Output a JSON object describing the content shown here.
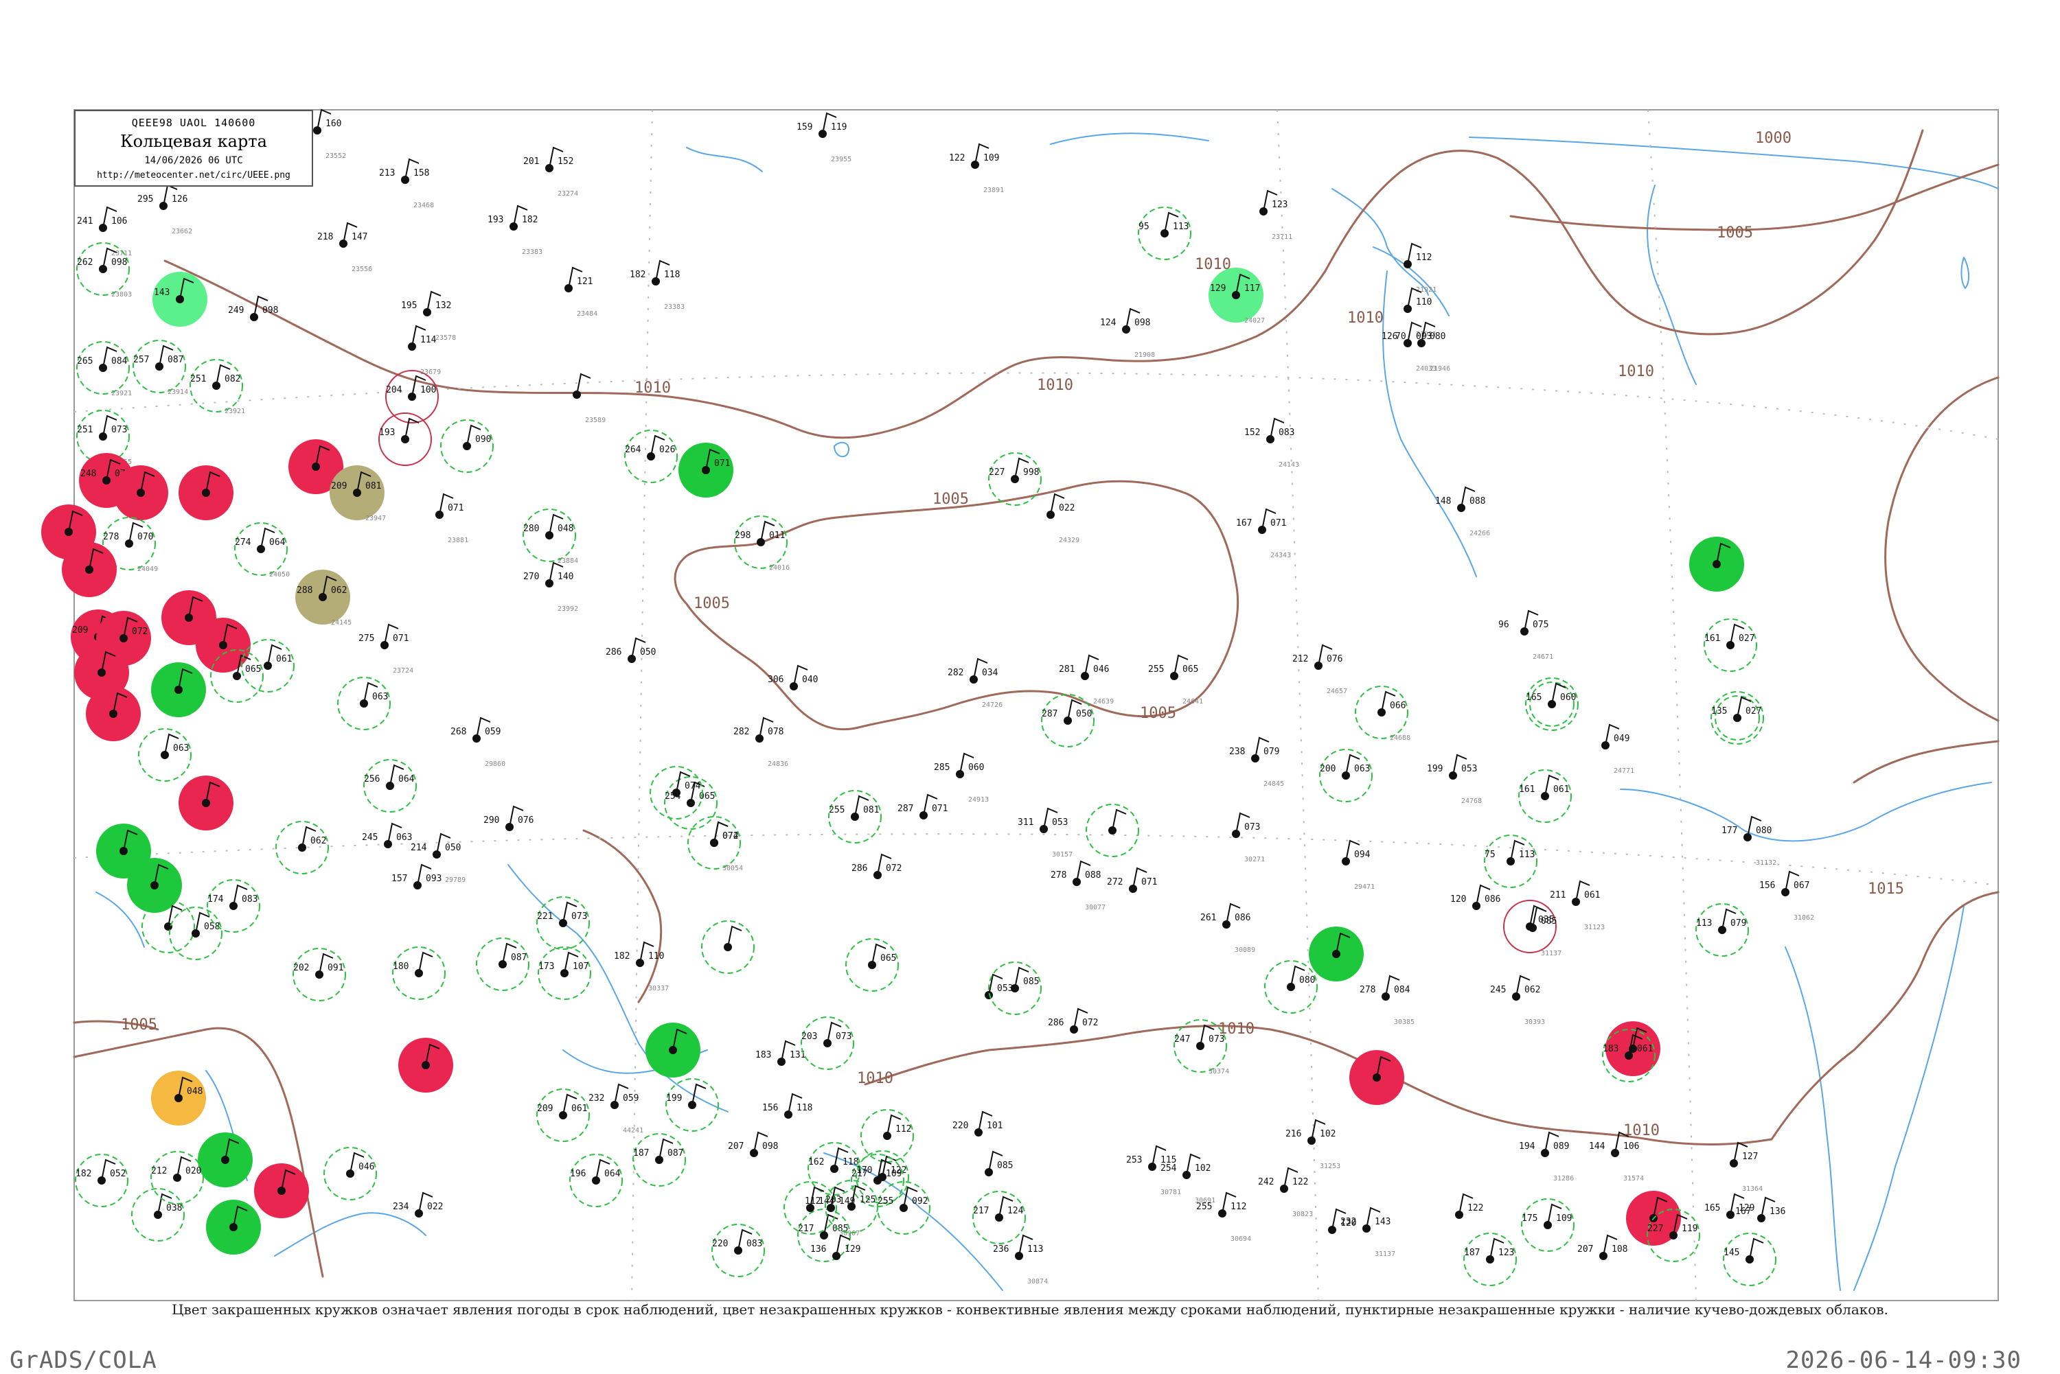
{
  "legend": {
    "code": "QEEE98  UAOL  140600",
    "title": "Кольцевая карта",
    "date": "14/06/2026 06 UTC",
    "url": "http://meteocenter.net/circ/UEEE.png"
  },
  "caption": "Цвет закрашенных кружков означает явления погоды в срок наблюдений, цвет незакрашенных кружков - конвективные явления между сроками наблюдений, пунктирные незакрашенные кружки - наличие кучево-дождевых облаков.",
  "footer": {
    "credit": "GrADS/COLA",
    "timestamp": "2026-06-14-09:30"
  },
  "colors": {
    "isobar": "#a0695a",
    "water": "#5aa6e6",
    "frame": "#999999",
    "red": "#e8264f",
    "green": "#1ec83c",
    "lightgreen": "#5cf08c",
    "olive": "#b5ad78",
    "orange": "#f5b840",
    "dash": "#2fbf44"
  },
  "isobar_labels": [
    "1000",
    "1005",
    "1005",
    "1005",
    "1005",
    "1010",
    "1010",
    "1010",
    "1010",
    "1010",
    "1010",
    "1010",
    "1010",
    "1015",
    "1005"
  ],
  "stations": [
    {
      "p": "160",
      "t": "",
      "n": "23552",
      "s": ""
    },
    {
      "p": "126",
      "t": "295",
      "n": "23662",
      "s": "s"
    },
    {
      "p": "106",
      "t": "241",
      "n": "23711",
      "s": ""
    },
    {
      "p": "098",
      "t": "262",
      "n": "23803",
      "s": "d"
    },
    {
      "p": "",
      "t": "143",
      "n": "",
      "s": "lg"
    },
    {
      "p": "098",
      "t": "249",
      "n": "",
      "s": ""
    },
    {
      "p": "084",
      "t": "265",
      "n": "23921",
      "s": "d"
    },
    {
      "p": "087",
      "t": "257",
      "n": "23914",
      "s": "d"
    },
    {
      "p": "082",
      "t": "251",
      "n": "23921",
      "s": "d"
    },
    {
      "p": "073",
      "t": "251",
      "n": "23955",
      "s": "d"
    },
    {
      "p": "074",
      "t": "248",
      "n": "",
      "s": "r"
    },
    {
      "p": "",
      "t": "",
      "n": "",
      "s": "r"
    },
    {
      "p": "",
      "t": "",
      "n": "",
      "s": "r"
    },
    {
      "p": "",
      "t": "",
      "n": "",
      "s": "r"
    },
    {
      "p": "070",
      "t": "278",
      "n": "24049",
      "s": "d"
    },
    {
      "p": "064",
      "t": "274",
      "n": "24050",
      "s": "d"
    },
    {
      "p": "",
      "t": "",
      "n": "",
      "s": "r"
    },
    {
      "p": "",
      "t": "",
      "n": "",
      "s": "r"
    },
    {
      "p": "",
      "t": "",
      "n": "",
      "s": "r"
    },
    {
      "p": "",
      "t": "",
      "n": "",
      "s": "r"
    },
    {
      "p": "",
      "t": "209",
      "n": "",
      "s": "r"
    },
    {
      "p": "081",
      "t": "209",
      "n": "23947",
      "s": "o"
    },
    {
      "p": "062",
      "t": "288",
      "n": "24145",
      "s": "o"
    },
    {
      "p": "100",
      "t": "204",
      "n": "",
      "s": "rr"
    },
    {
      "p": "",
      "t": "193",
      "n": "",
      "s": "rr"
    },
    {
      "p": "090",
      "t": "",
      "n": "",
      "s": "d"
    },
    {
      "p": "158",
      "t": "213",
      "n": "23468",
      "s": ""
    },
    {
      "p": "147",
      "t": "218",
      "n": "23556",
      "s": ""
    },
    {
      "p": "132",
      "t": "195",
      "n": "23578",
      "s": ""
    },
    {
      "p": "114",
      "t": "",
      "n": "23679",
      "s": ""
    },
    {
      "p": "152",
      "t": "201",
      "n": "23274",
      "s": ""
    },
    {
      "p": "182",
      "t": "193",
      "n": "23383",
      "s": ""
    },
    {
      "p": "121",
      "t": "",
      "n": "23484",
      "s": ""
    },
    {
      "p": "118",
      "t": "182",
      "n": "23383",
      "s": ""
    },
    {
      "p": "026",
      "t": "264",
      "n": "",
      "s": "d"
    },
    {
      "p": "071",
      "t": "",
      "n": "",
      "s": "g"
    },
    {
      "p": "",
      "t": "",
      "n": "23589",
      "s": ""
    },
    {
      "p": "071",
      "t": "",
      "n": "23881",
      "s": ""
    },
    {
      "p": "048",
      "t": "280",
      "n": "23884",
      "s": "d"
    },
    {
      "p": "140",
      "t": "270",
      "n": "23992",
      "s": ""
    },
    {
      "p": "011",
      "t": "298",
      "n": "24016",
      "s": "d"
    },
    {
      "p": "119",
      "t": "159",
      "n": "23955",
      "s": ""
    },
    {
      "p": "109",
      "t": "122",
      "n": "23891",
      "s": ""
    },
    {
      "p": "113",
      "t": "95",
      "n": "",
      "s": "d"
    },
    {
      "p": "117",
      "t": "129",
      "n": "24027",
      "s": "lg"
    },
    {
      "p": "123",
      "t": "",
      "n": "23711",
      "s": ""
    },
    {
      "p": "098",
      "t": "124",
      "n": "21908",
      "s": ""
    },
    {
      "p": "112",
      "t": "",
      "n": "21921",
      "s": ""
    },
    {
      "p": "110",
      "t": "",
      "n": "21931",
      "s": ""
    },
    {
      "p": "093",
      "t": "126",
      "n": "24033",
      "s": ""
    },
    {
      "p": "083",
      "t": "152",
      "n": "24143",
      "s": ""
    },
    {
      "p": "080",
      "t": "70",
      "n": "21946",
      "s": ""
    },
    {
      "p": "998",
      "t": "227",
      "n": "",
      "s": "d"
    },
    {
      "p": "022",
      "t": "",
      "n": "24329",
      "s": ""
    },
    {
      "p": "071",
      "t": "167",
      "n": "24343",
      "s": ""
    },
    {
      "p": "088",
      "t": "148",
      "n": "24266",
      "s": ""
    },
    {
      "p": "",
      "t": "",
      "n": "",
      "s": "g"
    },
    {
      "p": "071",
      "t": "275",
      "n": "23724",
      "s": ""
    },
    {
      "p": "050",
      "t": "286",
      "n": "",
      "s": ""
    },
    {
      "p": "040",
      "t": "306",
      "n": "",
      "s": ""
    },
    {
      "p": "034",
      "t": "282",
      "n": "24726",
      "s": ""
    },
    {
      "p": "046",
      "t": "281",
      "n": "24639",
      "s": ""
    },
    {
      "p": "065",
      "t": "255",
      "n": "24641",
      "s": ""
    },
    {
      "p": "050",
      "t": "287",
      "n": "",
      "s": "d"
    },
    {
      "p": "076",
      "t": "212",
      "n": "24657",
      "s": ""
    },
    {
      "p": "075",
      "t": "96",
      "n": "24671",
      "s": ""
    },
    {
      "p": "027",
      "t": "161",
      "n": "",
      "s": "d"
    },
    {
      "p": "060",
      "t": "165",
      "n": "",
      "s": "dd"
    },
    {
      "p": "027",
      "t": "135",
      "n": "",
      "s": "dd"
    },
    {
      "p": "066",
      "t": "",
      "n": "24688",
      "s": "d"
    },
    {
      "p": "",
      "t": "",
      "n": "",
      "s": "g"
    },
    {
      "p": "072",
      "t": "",
      "n": "",
      "s": "r"
    },
    {
      "p": "",
      "t": "",
      "n": "",
      "s": "r"
    },
    {
      "p": "",
      "t": "",
      "n": "",
      "s": "r"
    },
    {
      "p": "065",
      "t": "",
      "n": "",
      "s": "d"
    },
    {
      "p": "061",
      "t": "",
      "n": "",
      "s": "d"
    },
    {
      "p": "063",
      "t": "",
      "n": "",
      "s": "d"
    },
    {
      "p": "059",
      "t": "268",
      "n": "29860",
      "s": ""
    },
    {
      "p": "078",
      "t": "282",
      "n": "24836",
      "s": ""
    },
    {
      "p": "060",
      "t": "285",
      "n": "24913",
      "s": ""
    },
    {
      "p": "071",
      "t": "287",
      "n": "",
      "s": ""
    },
    {
      "p": "065",
      "t": "254",
      "n": "",
      "s": "d"
    },
    {
      "p": "074",
      "t": "",
      "n": "",
      "s": "d"
    },
    {
      "p": "079",
      "t": "238",
      "n": "24845",
      "s": ""
    },
    {
      "p": "063",
      "t": "200",
      "n": "",
      "s": "d"
    },
    {
      "p": "053",
      "t": "199",
      "n": "24768",
      "s": ""
    },
    {
      "p": "061",
      "t": "161",
      "n": "",
      "s": "d"
    },
    {
      "p": "049",
      "t": "",
      "n": "24771",
      "s": ""
    },
    {
      "p": "",
      "t": "",
      "n": "",
      "s": "g"
    },
    {
      "p": "063",
      "t": "",
      "n": "",
      "s": "d"
    },
    {
      "p": "064",
      "t": "256",
      "n": "",
      "s": "d"
    },
    {
      "p": "063",
      "t": "245",
      "n": "",
      "s": ""
    },
    {
      "p": "",
      "t": "",
      "n": "",
      "s": "r"
    },
    {
      "p": "",
      "t": "",
      "n": "",
      "s": "g"
    },
    {
      "p": "",
      "t": "",
      "n": "",
      "s": "d"
    },
    {
      "p": "058",
      "t": "",
      "n": "",
      "s": "d"
    },
    {
      "p": "083",
      "t": "174",
      "n": "",
      "s": "d"
    },
    {
      "p": "062",
      "t": "",
      "n": "",
      "s": "d"
    },
    {
      "p": "050",
      "t": "214",
      "n": "29789",
      "s": ""
    },
    {
      "p": "076",
      "t": "290",
      "n": "",
      "s": ""
    },
    {
      "p": "093",
      "t": "157",
      "n": "",
      "s": ""
    },
    {
      "p": "072",
      "t": "",
      "n": "30054",
      "s": ""
    },
    {
      "p": "074",
      "t": "",
      "n": "",
      "s": "d"
    },
    {
      "p": "081",
      "t": "255",
      "n": "",
      "s": "d"
    },
    {
      "p": "072",
      "t": "286",
      "n": "",
      "s": ""
    },
    {
      "p": "053",
      "t": "311",
      "n": "30157",
      "s": ""
    },
    {
      "p": "",
      "t": "",
      "n": "",
      "s": "d"
    },
    {
      "p": "088",
      "t": "278",
      "n": "30077",
      "s": ""
    },
    {
      "p": "071",
      "t": "272",
      "n": "",
      "s": ""
    },
    {
      "p": "073",
      "t": "",
      "n": "30271",
      "s": ""
    },
    {
      "p": "086",
      "t": "261",
      "n": "30089",
      "s": ""
    },
    {
      "p": "094",
      "t": "",
      "n": "29471",
      "s": ""
    },
    {
      "p": "",
      "t": "",
      "n": "",
      "s": "d"
    },
    {
      "p": "073",
      "t": "221",
      "n": "",
      "s": "d"
    },
    {
      "p": "087",
      "t": "",
      "n": "",
      "s": "d"
    },
    {
      "p": "110",
      "t": "182",
      "n": "30337",
      "s": ""
    },
    {
      "p": "107",
      "t": "173",
      "n": "",
      "s": "d"
    },
    {
      "p": "091",
      "t": "202",
      "n": "",
      "s": "d"
    },
    {
      "p": "",
      "t": "180",
      "n": "",
      "s": "d"
    },
    {
      "p": "131",
      "t": "183",
      "n": "",
      "s": ""
    },
    {
      "p": "073",
      "t": "203",
      "n": "",
      "s": "d"
    },
    {
      "p": "065",
      "t": "",
      "n": "",
      "s": "d"
    },
    {
      "p": "053",
      "t": "",
      "n": "",
      "s": ""
    },
    {
      "p": "085",
      "t": "",
      "n": "",
      "s": "d"
    },
    {
      "p": "072",
      "t": "286",
      "n": "",
      "s": ""
    },
    {
      "p": "073",
      "t": "247",
      "n": "30374",
      "s": "d"
    },
    {
      "p": "080",
      "t": "",
      "n": "",
      "s": "d"
    },
    {
      "p": "084",
      "t": "278",
      "n": "30385",
      "s": ""
    },
    {
      "p": "062",
      "t": "245",
      "n": "30393",
      "s": ""
    },
    {
      "p": "061",
      "t": "211",
      "n": "31123",
      "s": ""
    },
    {
      "p": "080",
      "t": "177",
      "n": "31132",
      "s": ""
    },
    {
      "p": "067",
      "t": "156",
      "n": "31062",
      "s": ""
    },
    {
      "p": "079",
      "t": "113",
      "n": "",
      "s": "d"
    },
    {
      "p": "113",
      "t": "75",
      "n": "",
      "s": "d"
    },
    {
      "p": "086",
      "t": "120",
      "n": "",
      "s": ""
    },
    {
      "p": "035",
      "t": "",
      "n": "",
      "s": "rr"
    },
    {
      "p": "",
      "t": "",
      "n": "",
      "s": "r"
    },
    {
      "p": "",
      "t": "",
      "n": "",
      "s": "r"
    },
    {
      "p": "",
      "t": "",
      "n": "",
      "s": "g"
    },
    {
      "p": "085",
      "t": "",
      "n": "31137",
      "s": ""
    },
    {
      "p": "061",
      "t": "183",
      "n": "",
      "s": "d"
    },
    {
      "p": "",
      "t": "",
      "n": "",
      "s": "r"
    },
    {
      "p": "",
      "t": "",
      "n": "",
      "s": "r"
    },
    {
      "p": "",
      "t": "",
      "n": "",
      "s": "g"
    },
    {
      "p": "",
      "t": "",
      "n": "",
      "s": "g"
    },
    {
      "p": "038",
      "t": "",
      "n": "",
      "s": "d"
    },
    {
      "p": "052",
      "t": "182",
      "n": "",
      "s": "d"
    },
    {
      "p": "048",
      "t": "",
      "n": "",
      "s": "y"
    },
    {
      "p": "020",
      "t": "212",
      "n": "",
      "s": "d"
    },
    {
      "p": "022",
      "t": "234",
      "n": "",
      "s": ""
    },
    {
      "p": "046",
      "t": "",
      "n": "",
      "s": "d"
    },
    {
      "p": "061",
      "t": "209",
      "n": "",
      "s": "d"
    },
    {
      "p": "059",
      "t": "232",
      "n": "44241",
      "s": ""
    },
    {
      "p": "064",
      "t": "196",
      "n": "",
      "s": "d"
    },
    {
      "p": "",
      "t": "",
      "n": "",
      "s": "g"
    },
    {
      "p": "087",
      "t": "187",
      "n": "",
      "s": "d"
    },
    {
      "p": "",
      "t": "199",
      "n": "",
      "s": "d"
    },
    {
      "p": "118",
      "t": "156",
      "n": "",
      "s": ""
    },
    {
      "p": "118",
      "t": "162",
      "n": "",
      "s": "d"
    },
    {
      "p": "098",
      "t": "207",
      "n": "",
      "s": ""
    },
    {
      "p": "085",
      "t": "217",
      "n": "",
      "s": "d"
    },
    {
      "p": "083",
      "t": "220",
      "n": "",
      "s": "d"
    },
    {
      "p": "112",
      "t": "",
      "n": "",
      "s": "d"
    },
    {
      "p": "122",
      "t": "170",
      "n": "",
      "s": "d"
    },
    {
      "p": "149",
      "t": "112",
      "n": "30967",
      "s": ""
    },
    {
      "p": "129",
      "t": "136",
      "n": "",
      "s": ""
    },
    {
      "p": "144",
      "t": "",
      "n": "",
      "s": "d"
    },
    {
      "p": "101",
      "t": "220",
      "n": "",
      "s": ""
    },
    {
      "p": "109",
      "t": "217",
      "n": "",
      "s": "d"
    },
    {
      "p": "125",
      "t": "203",
      "n": "",
      "s": "d"
    },
    {
      "p": "092",
      "t": "255",
      "n": "",
      "s": "d"
    },
    {
      "p": "085",
      "t": "",
      "n": "",
      "s": ""
    },
    {
      "p": "113",
      "t": "236",
      "n": "30874",
      "s": ""
    },
    {
      "p": "124",
      "t": "217",
      "n": "",
      "s": "d"
    },
    {
      "p": "115",
      "t": "253",
      "n": "30781",
      "s": ""
    },
    {
      "p": "102",
      "t": "254",
      "n": "30691",
      "s": ""
    },
    {
      "p": "112",
      "t": "255",
      "n": "30694",
      "s": ""
    },
    {
      "p": "122",
      "t": "242",
      "n": "30823",
      "s": ""
    },
    {
      "p": "120",
      "t": "",
      "n": "",
      "s": ""
    },
    {
      "p": "143",
      "t": "232",
      "n": "31137",
      "s": ""
    },
    {
      "p": "122",
      "t": "",
      "n": "",
      "s": ""
    },
    {
      "p": "123",
      "t": "187",
      "n": "",
      "s": "d"
    },
    {
      "p": "109",
      "t": "175",
      "n": "",
      "s": "d"
    },
    {
      "p": "",
      "t": "",
      "n": "",
      "s": "r"
    },
    {
      "p": "108",
      "t": "207",
      "n": "",
      "s": ""
    },
    {
      "p": "089",
      "t": "194",
      "n": "31286",
      "s": ""
    },
    {
      "p": "106",
      "t": "144",
      "n": "31574",
      "s": ""
    },
    {
      "p": "119",
      "t": "227",
      "n": "",
      "s": "d"
    },
    {
      "p": "127",
      "t": "",
      "n": "31364",
      "s": ""
    },
    {
      "p": "129",
      "t": "165",
      "n": "",
      "s": ""
    },
    {
      "p": "136",
      "t": "167",
      "n": "",
      "s": ""
    },
    {
      "p": "",
      "t": "145",
      "n": "",
      "s": "d"
    },
    {
      "p": "102",
      "t": "216",
      "n": "31253",
      "s": ""
    }
  ]
}
